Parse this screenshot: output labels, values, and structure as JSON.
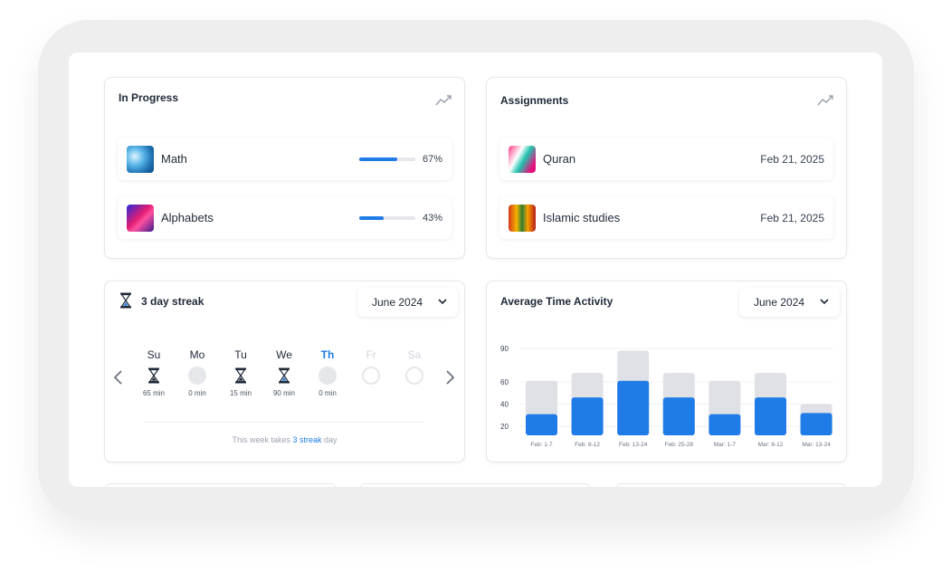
{
  "in_progress": {
    "title": "In Progress",
    "items": [
      {
        "label": "Math",
        "progress": 0.67,
        "percent_label": "67%"
      },
      {
        "label": "Alphabets",
        "progress": 0.43,
        "percent_label": "43%"
      }
    ]
  },
  "assignments": {
    "title": "Assignments",
    "items": [
      {
        "label": "Quran",
        "date": "Feb 21, 2025"
      },
      {
        "label": "Islamic studies",
        "date": "Feb 21, 2025"
      }
    ]
  },
  "streak": {
    "title": "3 day streak",
    "month_selector": "June 2024",
    "days": [
      {
        "name": "Su",
        "status": "done",
        "minutes": "65 min"
      },
      {
        "name": "Mo",
        "status": "missed",
        "minutes": "0 min"
      },
      {
        "name": "Tu",
        "status": "done",
        "minutes": "15 min"
      },
      {
        "name": "We",
        "status": "active",
        "minutes": "90 min"
      },
      {
        "name": "Th",
        "status": "today",
        "minutes": "0 min"
      },
      {
        "name": "Fr",
        "status": "future",
        "minutes": ""
      },
      {
        "name": "Sa",
        "status": "future",
        "minutes": ""
      }
    ],
    "note_prefix": "This week takes",
    "note_highlight": "3 streak",
    "note_suffix": "day"
  },
  "activity": {
    "title": "Average Time Activity",
    "month_selector": "June 2024"
  },
  "colors": {
    "accent": "#1f7be6",
    "bar_bg": "#dfe1e6",
    "muted_day": "#d1d5db"
  },
  "chart_data": {
    "type": "bar",
    "categories": [
      "Feb: 1-7",
      "Feb: 8-12",
      "Feb: 13-24",
      "Feb: 25-28",
      "Mar: 1-7",
      "Mar: 8-12",
      "Mar: 13-24"
    ],
    "series": [
      {
        "values": [
          61,
          68,
          88,
          68,
          61,
          68,
          40
        ]
      },
      {
        "values": [
          31,
          46,
          61,
          46,
          31,
          46,
          32
        ]
      }
    ],
    "yticks": [
      20,
      40,
      60,
      90
    ],
    "ylim": [
      12,
      90
    ],
    "grid": true
  }
}
